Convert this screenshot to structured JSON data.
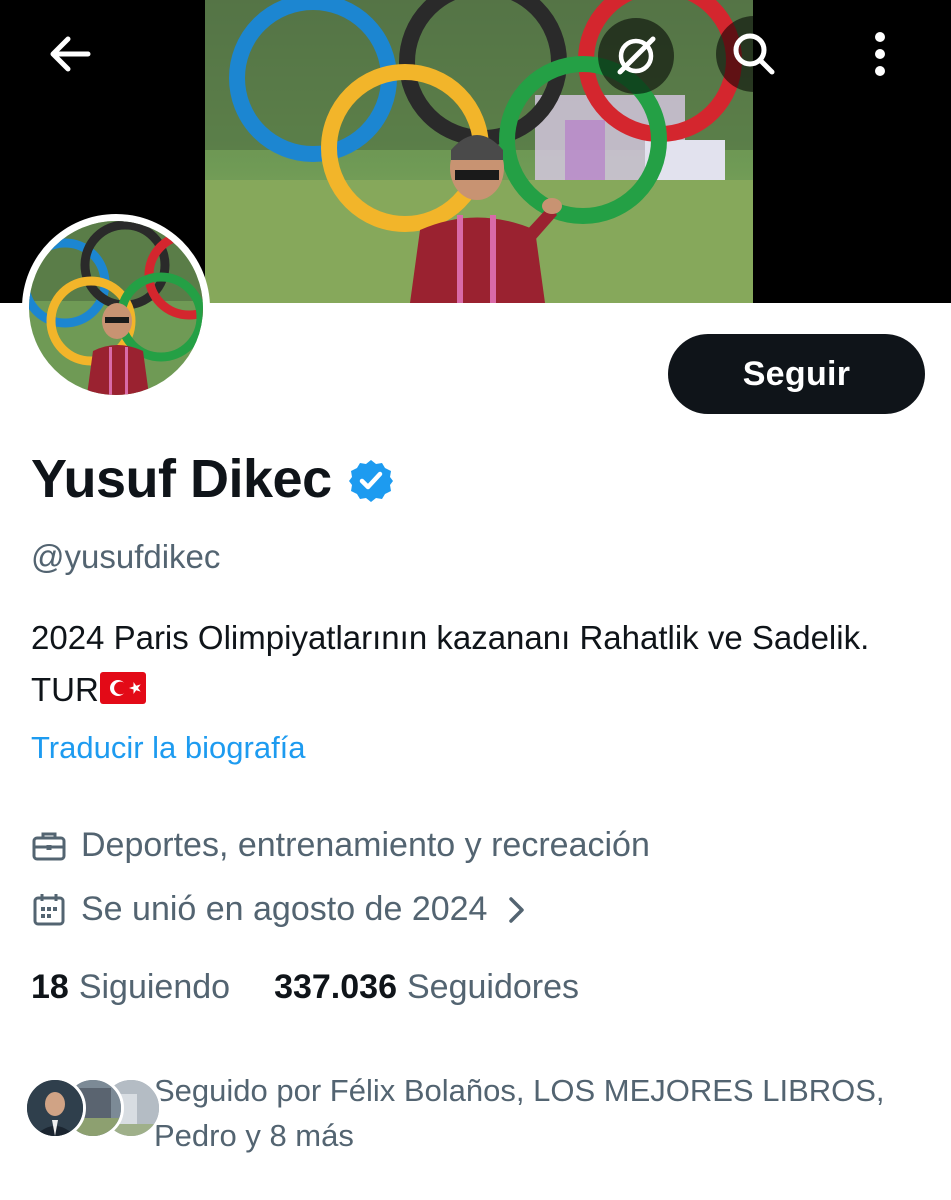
{
  "header": {
    "back_icon": "arrow-left-icon",
    "grok_icon": "grok-icon",
    "search_icon": "search-icon",
    "more_icon": "more-vertical-icon"
  },
  "profile": {
    "display_name": "Yusuf Dikec",
    "verified": true,
    "handle": "@yusufdikec",
    "bio_text": "2024 Paris Olimpiyatlarının kazananı Rahatlik ve Sadelik. TUR",
    "bio_flag": "flag-turkey-icon",
    "translate_label": "Traducir la biografía",
    "category": "Deportes, entrenamiento y recreación",
    "joined": "Se unió en agosto de 2024"
  },
  "actions": {
    "follow_label": "Seguir"
  },
  "stats": {
    "following_count": "18",
    "following_label": "Siguiendo",
    "followers_count": "337.036",
    "followers_label": "Seguidores"
  },
  "followed_by": {
    "text": "Seguido por Félix Bolaños, LOS MEJORES LIBROS, Pedro y 8 más"
  },
  "colors": {
    "text_primary": "#0f1419",
    "text_secondary": "#536471",
    "accent_blue": "#1d9bf0",
    "follow_button_bg": "#0f1419"
  }
}
